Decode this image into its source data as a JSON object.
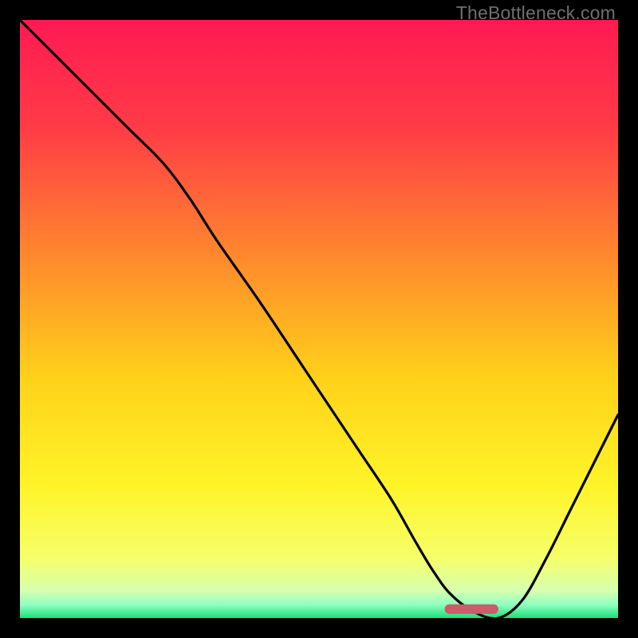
{
  "watermark": "TheBottleneck.com",
  "chart_data": {
    "type": "line",
    "title": "",
    "xlabel": "",
    "ylabel": "",
    "xlim": [
      0,
      100
    ],
    "ylim": [
      0,
      100
    ],
    "gradient_stops": [
      {
        "offset": 0.0,
        "color": "#ff1a52"
      },
      {
        "offset": 0.18,
        "color": "#ff3b47"
      },
      {
        "offset": 0.4,
        "color": "#ff8a2c"
      },
      {
        "offset": 0.6,
        "color": "#ffd21a"
      },
      {
        "offset": 0.78,
        "color": "#fff428"
      },
      {
        "offset": 0.9,
        "color": "#f6ff6a"
      },
      {
        "offset": 0.955,
        "color": "#d6ffb0"
      },
      {
        "offset": 0.978,
        "color": "#8effc0"
      },
      {
        "offset": 1.0,
        "color": "#18e07a"
      }
    ],
    "series": [
      {
        "name": "bottleneck-curve",
        "x": [
          0,
          6,
          12,
          18,
          24,
          28.5,
          33,
          40,
          48,
          56,
          62,
          66,
          69,
          72,
          76,
          80,
          84,
          88,
          92,
          96,
          100
        ],
        "y": [
          100,
          94,
          88,
          82,
          76,
          70,
          63,
          53,
          41,
          29,
          20,
          13,
          8,
          4,
          1,
          0,
          3,
          10,
          18,
          26,
          34
        ]
      }
    ],
    "marker": {
      "name": "optimal-band",
      "x_start": 71,
      "x_end": 80,
      "y": 1.5,
      "color": "#cf5a6a"
    }
  }
}
